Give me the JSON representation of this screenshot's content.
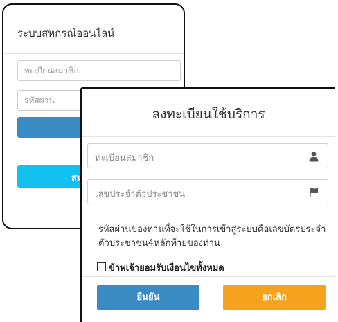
{
  "login": {
    "title": "ระบบสหกรณ์ออนไลน์",
    "member_placeholder": "ทะเบียนสมาชิก",
    "password_placeholder": "รหัสผ่าน",
    "signup_partial": "สม"
  },
  "register": {
    "title": "ลงทะเบียนใช้บริการ",
    "member_placeholder": "ทะเบียนสมาชิก",
    "idcard_placeholder": "เลขประจำตัวประชาชน",
    "hint_text": "รหัสผ่านของท่านที่จะใช้ในการเข้าสู่ระบบคือเลขบัตรประจำตัวประชาชน4หลักท้ายของท่าน",
    "agree_label": "ข้าพเจ้ายอมรับเงื่อนไขทั้งหมด",
    "confirm_label": "ยืนยัน",
    "cancel_label": "ยกเลิก",
    "member_icon": "user-icon",
    "idcard_icon": "flag-icon"
  },
  "colors": {
    "primary": "#3a8bc4",
    "accent_cyan": "#12c1ef",
    "warning": "#f5a21f"
  }
}
